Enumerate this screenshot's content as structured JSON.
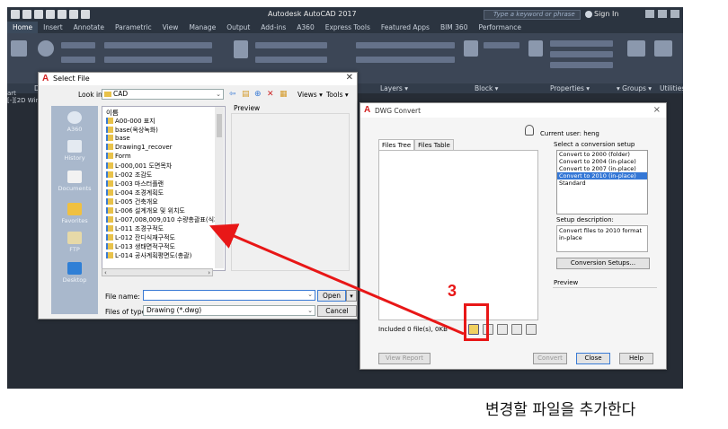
{
  "app": {
    "title": "Autodesk AutoCAD 2017",
    "search_placeholder": "Type a keyword or phrase",
    "signin": "Sign In"
  },
  "ribbon": {
    "tabs": [
      "Home",
      "Insert",
      "Annotate",
      "Parametric",
      "View",
      "Manage",
      "Output",
      "Add-ins",
      "A360",
      "Express Tools",
      "Featured Apps",
      "BIM 360",
      "Performance"
    ],
    "panels": [
      "Layers ▾",
      "Block ▾",
      "Properties ▾",
      "▾ Groups ▾",
      "Utilities"
    ]
  },
  "drawing": {
    "viewport_label": "[-][2D Wirefr",
    "left_stub": "art"
  },
  "select_file": {
    "title": "Select File",
    "look_in_label": "Look in:",
    "look_in_value": "CAD",
    "views_label": "Views",
    "tools_label": "Tools",
    "preview_label": "Preview",
    "places": [
      "A360",
      "History",
      "Documents",
      "Favorites",
      "FTP",
      "Desktop"
    ],
    "list_header": "이름",
    "files": [
      "A00-000 표지",
      "base(옥상녹화)",
      "base",
      "Drawing1_recover",
      "Form",
      "L-000,001 도면목차",
      "L-002 조감도",
      "L-003 마스터플랜",
      "L-004 조경계획도",
      "L-005 건축개요",
      "L-006 설계개요 및 위치도",
      "L-007,008,009,010 수량총괄표(식재",
      "L-011 조경구적도",
      "L-012 잔디식재구적도",
      "L-013 생태면적구적도",
      "L-014 공사계획평면도(총괄)"
    ],
    "file_name_label": "File name:",
    "file_name_value": "",
    "file_type_label": "Files of type:",
    "file_type_value": "Drawing (*.dwg)",
    "open_label": "Open",
    "cancel_label": "Cancel"
  },
  "dwg_convert": {
    "title": "DWG Convert",
    "current_user": "Current user: heng",
    "tabs": [
      "Files Tree",
      "Files Table"
    ],
    "setup_label": "Select a conversion setup",
    "setups": [
      "Convert to 2000 (folder)",
      "Convert to 2004 (in-place)",
      "Convert to 2007 (in-place)",
      "Convert to 2010 (in-place)",
      "Standard"
    ],
    "selected_setup": "Convert to 2010 (in-place)",
    "description_label": "Setup description:",
    "description": "Convert files to 2010 format in-place",
    "conversion_setups_label": "Conversion Setups...",
    "preview_label": "Preview",
    "included": "Included 0 file(s), 0KB",
    "view_report": "View Report",
    "convert": "Convert",
    "close": "Close",
    "help": "Help"
  },
  "annotation": {
    "step": "3",
    "caption": "변경할 파일을 추가한다",
    "color": "#e81717"
  }
}
